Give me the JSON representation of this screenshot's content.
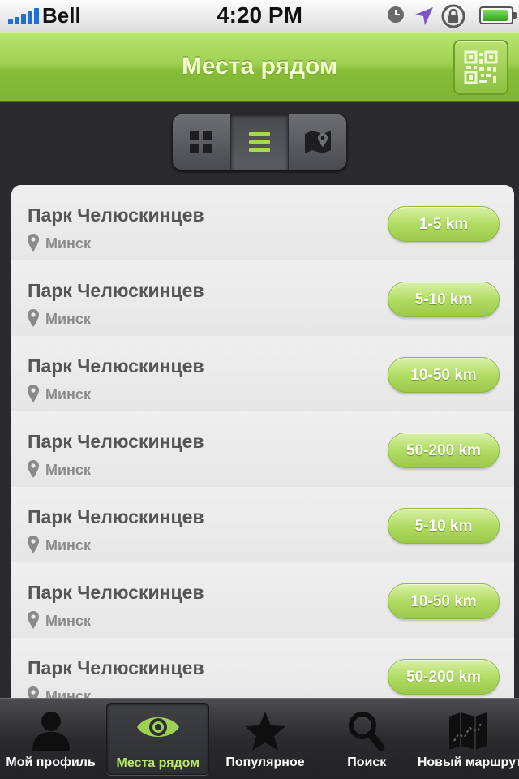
{
  "status_bar": {
    "carrier": "Bell",
    "time": "4:20 PM",
    "battery_level": 0.9
  },
  "nav": {
    "title": "Места рядом",
    "right_button_icon": "qr-code-icon"
  },
  "view_switcher": {
    "options": [
      {
        "icon": "grid-icon",
        "selected": false
      },
      {
        "icon": "list-icon",
        "selected": true
      },
      {
        "icon": "map-icon",
        "selected": false
      }
    ]
  },
  "places": [
    {
      "name": "Парк Челюскинцев",
      "city": "Минск",
      "distance": "1-5 km"
    },
    {
      "name": "Парк Челюскинцев",
      "city": "Минск",
      "distance": "5-10 km"
    },
    {
      "name": "Парк Челюскинцев",
      "city": "Минск",
      "distance": "10-50 km"
    },
    {
      "name": "Парк Челюскинцев",
      "city": "Минск",
      "distance": "50-200 km"
    },
    {
      "name": "Парк Челюскинцев",
      "city": "Минск",
      "distance": "5-10 km"
    },
    {
      "name": "Парк Челюскинцев",
      "city": "Минск",
      "distance": "10-50 km"
    },
    {
      "name": "Парк Челюскинцев",
      "city": "Минск",
      "distance": "50-200 km"
    }
  ],
  "tabs": [
    {
      "label": "Мой профиль",
      "icon": "profile-icon",
      "active": false
    },
    {
      "label": "Места рядом",
      "icon": "eye-icon",
      "active": true
    },
    {
      "label": "Популярное",
      "icon": "star-icon",
      "active": false
    },
    {
      "label": "Поиск",
      "icon": "search-icon",
      "active": false
    },
    {
      "label": "Новый маршрут",
      "icon": "route-map-icon",
      "active": false
    }
  ],
  "colors": {
    "accent_green": "#9fd052",
    "active_tab_label": "#b9e66a"
  }
}
